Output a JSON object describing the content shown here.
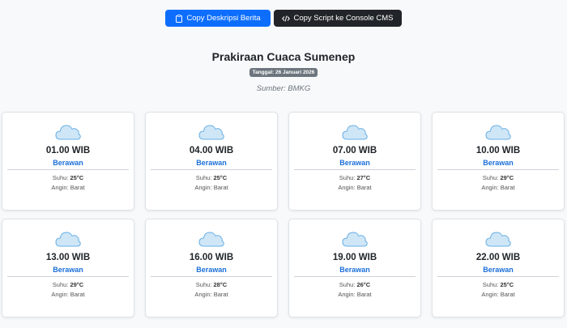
{
  "toolbar": {
    "copy_desc_label": "Copy Deskripsi Berita",
    "copy_script_label": "Copy Script ke Console CMS"
  },
  "header": {
    "title": "Prakiraan Cuaca Sumenep",
    "date_badge": "Tanggal: 26 Januari 2026",
    "source": "Sumber: BMKG"
  },
  "labels": {
    "temp_prefix": "Suhu: ",
    "wind_prefix": "Angin: "
  },
  "forecasts": [
    {
      "time": "01.00 WIB",
      "condition": "Berawan",
      "temp": "25°C",
      "wind": "Barat",
      "icon": "cloud-icon"
    },
    {
      "time": "04.00 WIB",
      "condition": "Berawan",
      "temp": "25°C",
      "wind": "Barat",
      "icon": "cloud-icon"
    },
    {
      "time": "07.00 WIB",
      "condition": "Berawan",
      "temp": "27°C",
      "wind": "Barat",
      "icon": "cloud-icon"
    },
    {
      "time": "10.00 WIB",
      "condition": "Berawan",
      "temp": "29°C",
      "wind": "Barat",
      "icon": "cloud-icon"
    },
    {
      "time": "13.00 WIB",
      "condition": "Berawan",
      "temp": "29°C",
      "wind": "Barat",
      "icon": "cloud-icon"
    },
    {
      "time": "16.00 WIB",
      "condition": "Berawan",
      "temp": "28°C",
      "wind": "Barat",
      "icon": "cloud-icon"
    },
    {
      "time": "19.00 WIB",
      "condition": "Berawan",
      "temp": "26°C",
      "wind": "Barat",
      "icon": "cloud-icon"
    },
    {
      "time": "22.00 WIB",
      "condition": "Berawan",
      "temp": "25°C",
      "wind": "Barat",
      "icon": "cloud-icon"
    }
  ],
  "colors": {
    "primary": "#0d6efd",
    "dark": "#212529",
    "condition_text": "#1a6ed8",
    "cloud_fill": "#cfe6f7",
    "cloud_stroke": "#6ab0e4"
  }
}
